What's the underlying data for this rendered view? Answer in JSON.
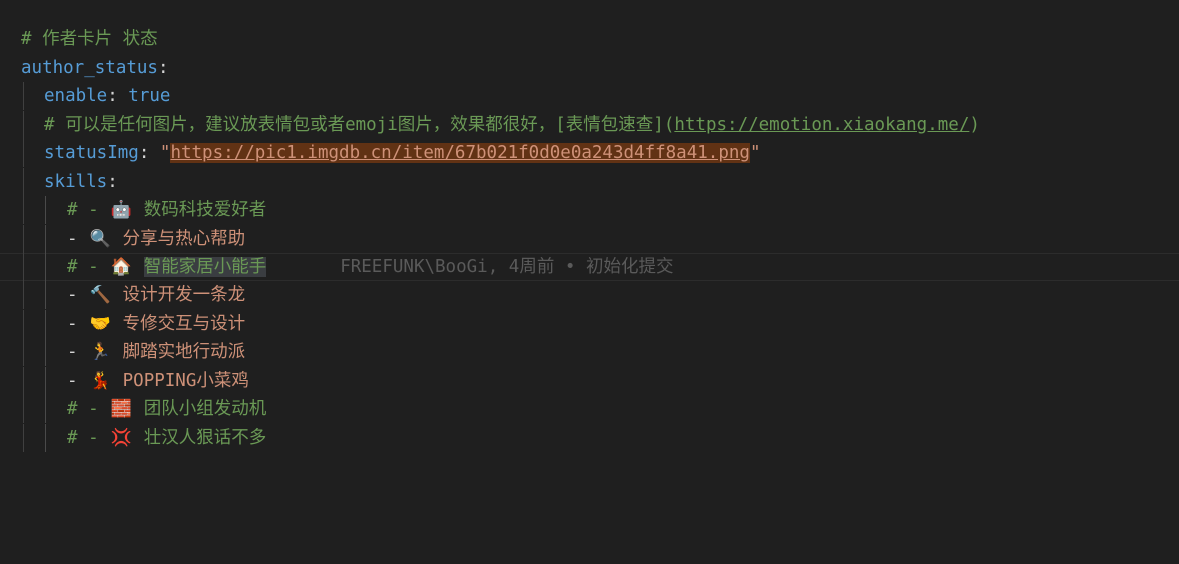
{
  "editor": {
    "theme_colors": {
      "background": "#1f1f1f",
      "comment": "#6a9955",
      "key": "#569cd6",
      "string": "#ce9178",
      "text": "#d4d4d4",
      "link_highlight": "#613214",
      "blame": "#5a5a5a"
    },
    "lines": {
      "l1_comment": "# 作者卡片 状态",
      "l2_key": "author_status",
      "l2_colon": ":",
      "l3_key": "enable",
      "l3_colon": ": ",
      "l3_value": "true",
      "l4_comment_prefix": "# 可以是任何图片，建议放表情包或者emoji图片，效果都很好，[表情包速查](",
      "l4_link": "https://emotion.xiaokang.me/",
      "l4_comment_suffix": ")",
      "l5_key": "statusImg",
      "l5_colon": ": ",
      "l5_quote_open": "\"",
      "l5_url": "https://pic1.imgdb.cn/item/67b021f0d0e0a243d4ff8a41.png",
      "l5_quote_close": "\"",
      "l6_key": "skills",
      "l6_colon": ":"
    },
    "skills": [
      {
        "prefix": "# - ",
        "emoji": "🤖",
        "emoji_name": "robot-icon",
        "text": "数码科技爱好者",
        "commented": true
      },
      {
        "prefix": "- ",
        "emoji": "🔍",
        "emoji_name": "magnifier-icon",
        "text": "分享与热心帮助",
        "commented": false
      },
      {
        "prefix": "# - ",
        "emoji": "🏠",
        "emoji_name": "house-icon",
        "text": "智能家居小能手",
        "commented": true
      },
      {
        "prefix": "- ",
        "emoji": "🔨",
        "emoji_name": "hammer-icon",
        "text": "设计开发一条龙",
        "commented": false
      },
      {
        "prefix": "- ",
        "emoji": "🤝",
        "emoji_name": "handshake-icon",
        "text": "专修交互与设计",
        "commented": false
      },
      {
        "prefix": "- ",
        "emoji": "🏃",
        "emoji_name": "runner-icon",
        "text": "脚踏实地行动派",
        "commented": false
      },
      {
        "prefix": "- ",
        "emoji": "💃",
        "emoji_name": "dancer-icon",
        "text": "POPPING小菜鸡",
        "commented": false
      },
      {
        "prefix": "# - ",
        "emoji": "🧱",
        "emoji_name": "bricks-icon",
        "text": "团队小组发动机",
        "commented": true
      },
      {
        "prefix": "# - ",
        "emoji": "💢",
        "emoji_name": "anger-icon",
        "text": "壮汉人狠话不多",
        "commented": true
      }
    ],
    "blame": {
      "author": "FREEFUNK\\BooGi",
      "separator": ", ",
      "time": "4周前",
      "bullet": " • ",
      "message": "初始化提交"
    }
  }
}
